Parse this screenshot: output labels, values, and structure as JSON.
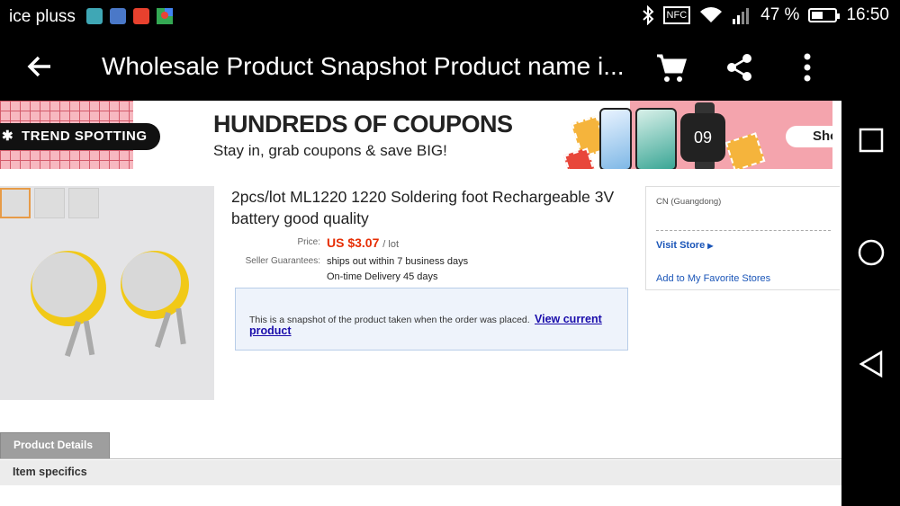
{
  "status_bar": {
    "carrier": "ice pluss",
    "nfc": "NFC",
    "battery": "47 %",
    "battery_level": 0.47,
    "time": "16:50"
  },
  "app_bar": {
    "title": "Wholesale Product Snapshot Product name i..."
  },
  "banner": {
    "tag": "TREND SPOTTING",
    "headline": "HUNDREDS OF COUPONS",
    "subline": "Stay in, grab coupons & save BIG!",
    "watch_time": "09",
    "shop_label": "Sho"
  },
  "product": {
    "title": "2pcs/lot ML1220 1220 Soldering foot Rechargeable 3V battery good quality",
    "price_label": "Price:",
    "price": "US $3.07",
    "price_unit": "/ lot",
    "guarantees_label": "Seller Guarantees:",
    "guarantee_1": "ships out within 7 business days",
    "guarantee_2": "On-time Delivery 45 days"
  },
  "snapshot_notice": {
    "text": "This is a snapshot of the product taken when the order was placed.",
    "link_part1": "View current",
    "link_part2": "product"
  },
  "store": {
    "location": "CN (Guangdong)",
    "visit": "Visit Store",
    "favorite": "Add to My Favorite Stores"
  },
  "tabs": {
    "product_details": "Product Details",
    "item_specifics": "Item specifics"
  },
  "colors": {
    "price": "#e62e04",
    "link": "#1a0dab",
    "store_link": "#1a55b8"
  }
}
